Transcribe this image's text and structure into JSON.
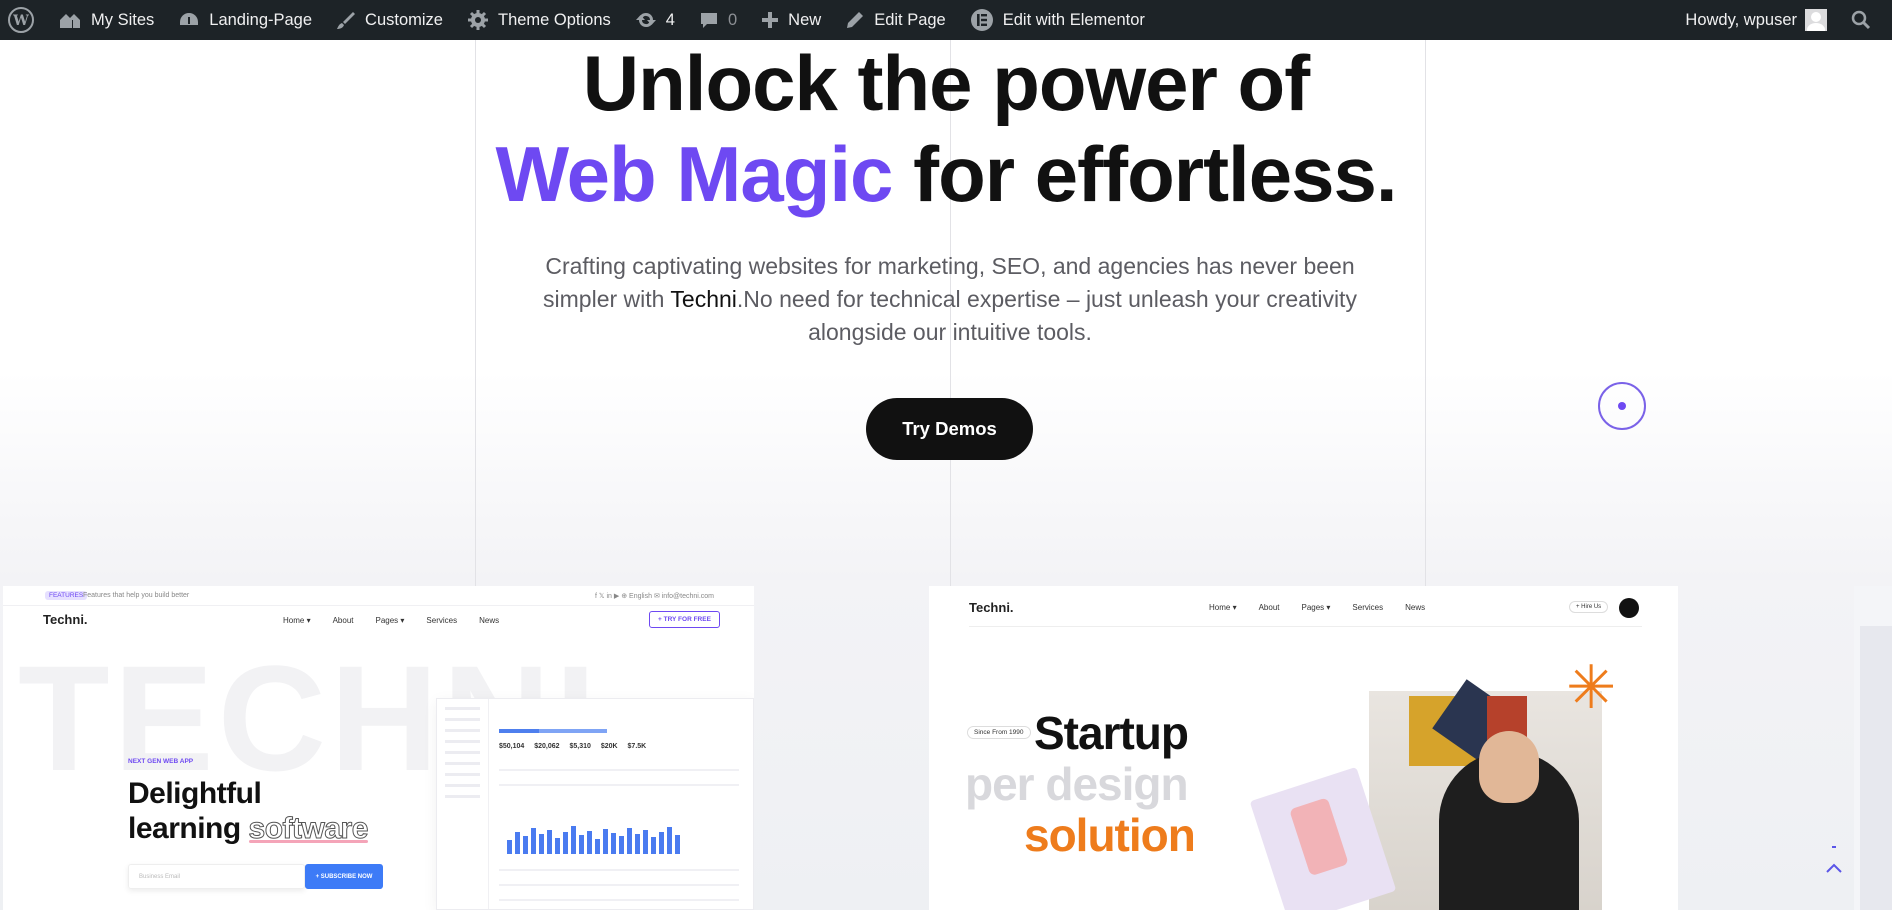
{
  "adminbar": {
    "my_sites": "My Sites",
    "site": "Landing-Page",
    "customize": "Customize",
    "theme_options": "Theme Options",
    "updates_count": "4",
    "comments_count": "0",
    "new": "New",
    "edit_page": "Edit Page",
    "edit_elementor": "Edit with Elementor",
    "howdy": "Howdy, wpuser"
  },
  "hero": {
    "line1": "Unlock the power of",
    "accent": "Web Magic",
    "line2_rest": " for effortless.",
    "para_pre": "Crafting captivating websites for marketing, SEO, and agencies has never been simpler with ",
    "brand": "Techni",
    "para_post": ".No need for technical expertise – just unleash your creativity alongside our intuitive tools.",
    "cta": "Try Demos",
    "accent_color": "#6e49f2"
  },
  "demo1": {
    "badge": "FEATURES",
    "tagline": "Features that help you build better",
    "top_right": "f  𝕏  in  ▶      ⊕ English      ✉ info@techni.com",
    "logo": "Techni.",
    "nav": [
      "Home ▾",
      "About",
      "Pages ▾",
      "Services",
      "News"
    ],
    "cta": "+ TRY FOR FREE",
    "watermark": "TECHNI",
    "kicker": "NEXT GEN WEB APP",
    "head1": "Delightful",
    "head2a": "learning ",
    "head2b": "software",
    "email_placeholder": "Business Email",
    "subscribe": "+ SUBSCRIBE NOW",
    "dash_numbers": "$50,104  $20,062  $5,310     $20K  $7.5K"
  },
  "demo2": {
    "logo": "Techni.",
    "nav": [
      "Home ▾",
      "About",
      "Pages ▾",
      "Services",
      "News"
    ],
    "hire": "+ Hire Us",
    "since": "Since From 1990",
    "h1": "Startup",
    "h2": "per design",
    "h3": "solution"
  }
}
